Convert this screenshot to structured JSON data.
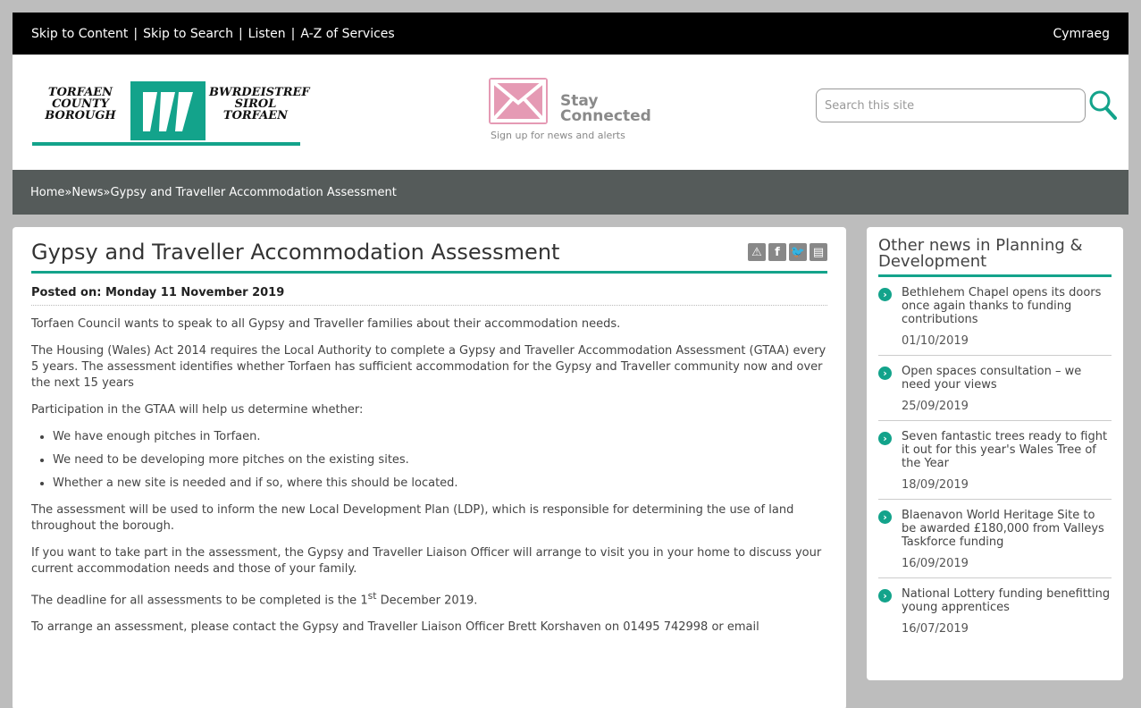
{
  "topbar": {
    "links": [
      "Skip to Content",
      "Skip to Search",
      "Listen",
      "A-Z of Services"
    ],
    "separator": "|",
    "language": "Cymraeg"
  },
  "logo": {
    "left": "TORFAEN\nCOUNTY\nBOROUGH",
    "right": "BWRDEISTREF\nSIROL\nTORFAEN"
  },
  "stay_connected": {
    "title": "Stay\nConnected",
    "subtitle": "Sign up for news and alerts"
  },
  "search": {
    "placeholder": "Search this site"
  },
  "breadcrumb": {
    "home": "Home",
    "sep": " » ",
    "news": "News",
    "current": "Gypsy and Traveller Accommodation Assessment"
  },
  "article": {
    "title": "Gypsy and Traveller Accommodation Assessment",
    "posted": "Posted on: Monday 11 November 2019",
    "p1": "Torfaen Council wants to speak to all Gypsy and Traveller families about their accommodation needs.",
    "p2": "The Housing (Wales) Act 2014 requires the Local Authority to complete a Gypsy and Traveller Accommodation Assessment (GTAA) every 5 years. The assessment identifies whether Torfaen has sufficient accommodation for the Gypsy and Traveller community now and over the next 15 years",
    "p3": "Participation in the GTAA will help us determine whether:",
    "bullets": [
      "We have enough pitches in Torfaen.",
      "We need to be developing more pitches on the existing sites.",
      "Whether a new site is needed and if so, where this should be located."
    ],
    "p4": "The assessment will be used to inform the new Local Development Plan (LDP), which is responsible for determining the use of land throughout the borough.",
    "p5": "If you want to take part in the assessment, the Gypsy and Traveller Liaison Officer will arrange to visit you in your home to discuss your current accommodation needs and those of your family.",
    "p6_pre": "The deadline for all assessments to be completed is the 1",
    "p6_sup": "st",
    "p6_post": " December 2019.",
    "p7": "To arrange an assessment, please contact the Gypsy and Traveller Liaison Officer Brett Korshaven on 01495 742998 or email"
  },
  "sidebar": {
    "title": "Other news in Planning & Development",
    "items": [
      {
        "text": "Bethlehem Chapel opens its doors once again thanks to funding contributions",
        "date": "01/10/2019"
      },
      {
        "text": "Open spaces consultation – we need your views",
        "date": "25/09/2019"
      },
      {
        "text": "Seven fantastic trees ready to fight it out for this year's Wales Tree of the Year",
        "date": "18/09/2019"
      },
      {
        "text": "Blaenavon World Heritage Site to be awarded £180,000 from Valleys Taskforce funding",
        "date": "16/09/2019"
      },
      {
        "text": "National Lottery funding benefitting young apprentices",
        "date": "16/07/2019"
      }
    ]
  },
  "colors": {
    "accent": "#13a38b",
    "breadcrumb_bg": "#555b5a",
    "stay_pink": "#e59ab4"
  }
}
